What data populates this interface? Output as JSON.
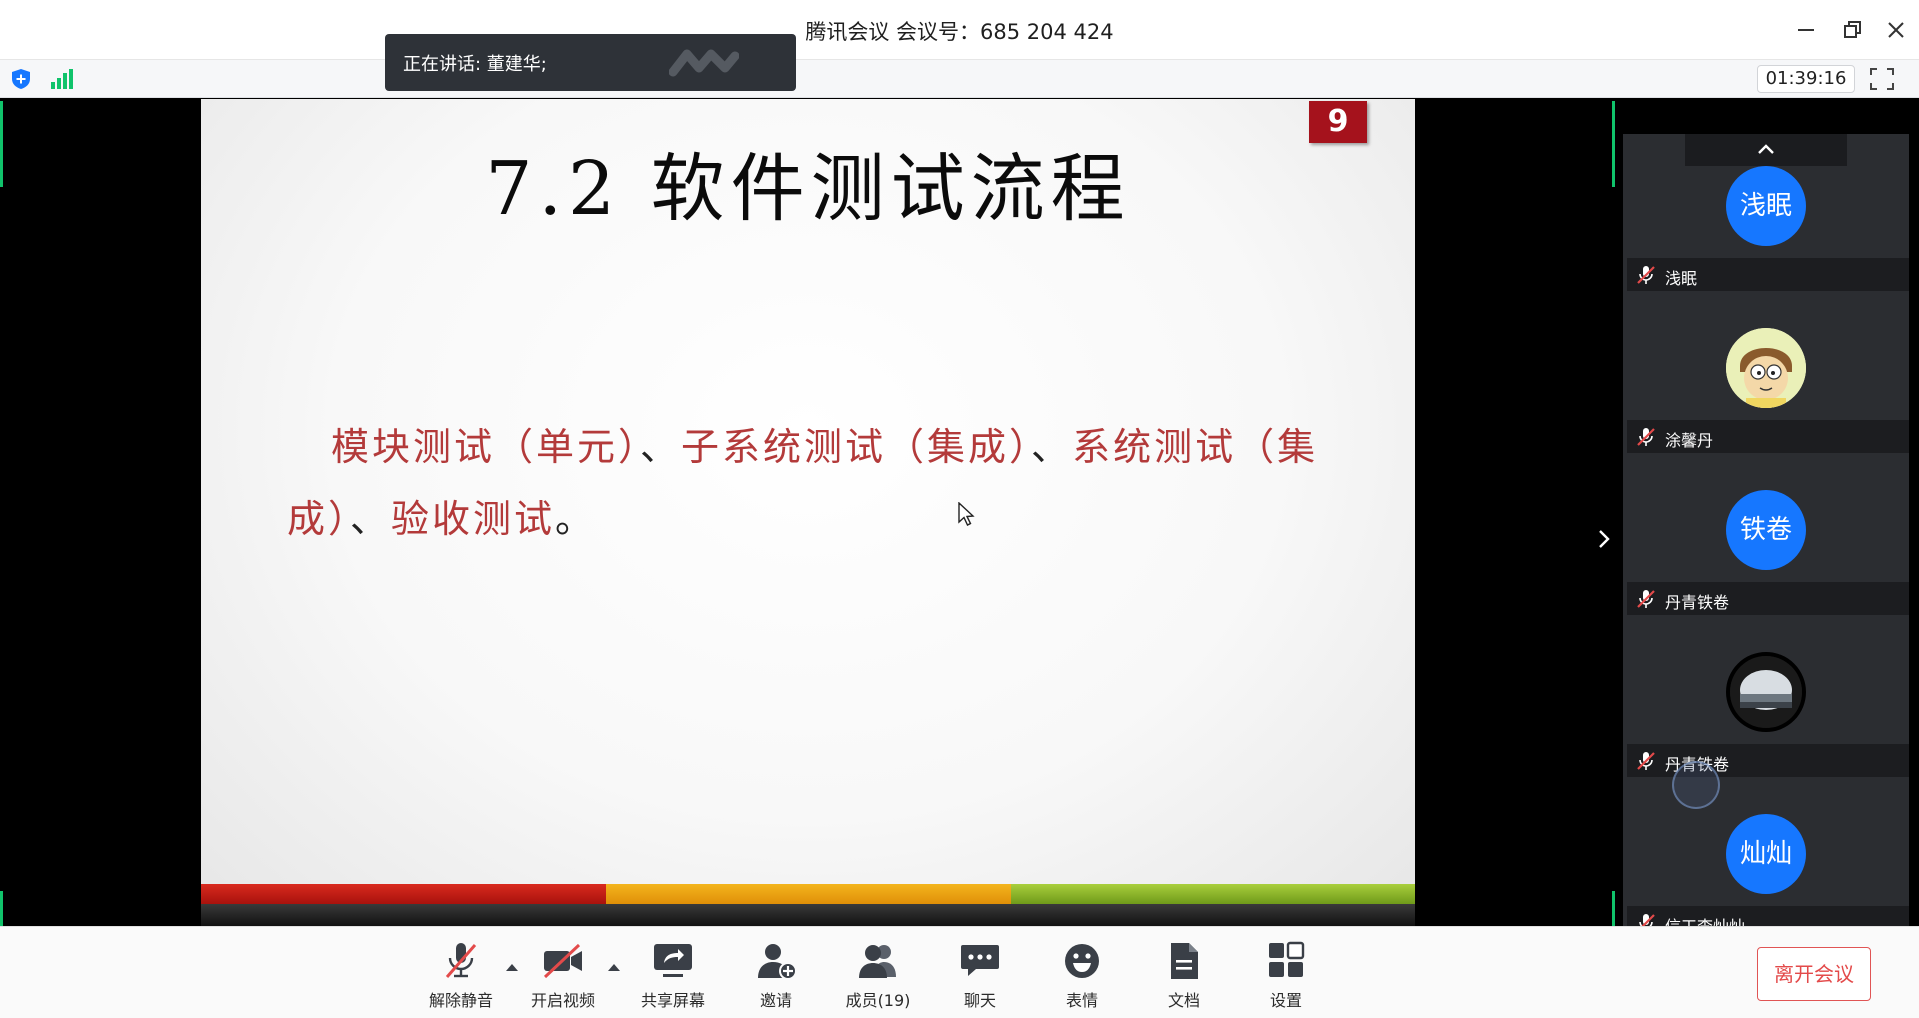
{
  "window": {
    "title": "腾讯会议 会议号：685 204 424",
    "elapsed_time": "01:39:16"
  },
  "speaking": {
    "text": "正在讲话: 董建华;"
  },
  "slide": {
    "page_number": "9",
    "title": "7.2 软件测试流程",
    "body_parts": [
      "模块测试（单元）",
      "、",
      "子系统测试（集成）",
      "、",
      "系统测试（集成）",
      "、",
      "验收测试",
      "。"
    ]
  },
  "participants": [
    {
      "avatar_text": "浅眠",
      "name": "浅眠",
      "avatar_kind": "initials",
      "color": "#1677ff"
    },
    {
      "avatar_text": "",
      "name": "涂馨丹",
      "avatar_kind": "cartoon"
    },
    {
      "avatar_text": "铁卷",
      "name": "丹青铁卷",
      "avatar_kind": "initials",
      "color": "#1677ff"
    },
    {
      "avatar_text": "",
      "name": "丹青铁卷",
      "avatar_kind": "photo"
    },
    {
      "avatar_text": "灿灿",
      "name": "信工李灿灿",
      "avatar_kind": "initials",
      "color": "#1677ff"
    }
  ],
  "controls": {
    "unmute": "解除静音",
    "start_video": "开启视频",
    "share_screen": "共享屏幕",
    "invite": "邀请",
    "members": "成员(19)",
    "chat": "聊天",
    "reactions": "表情",
    "docs": "文档",
    "settings": "设置",
    "leave": "离开会议"
  },
  "colors": {
    "accent_blue": "#1677ff",
    "slide_red": "#b33a3a",
    "badge_red": "#a5121c",
    "leave_red": "#e34a4a",
    "active_green": "#10c36b"
  },
  "icons": [
    "shield-icon",
    "signal-icon",
    "minimize-icon",
    "restore-icon",
    "close-icon",
    "fullscreen-icon",
    "chevron-up-icon",
    "chevron-right-icon",
    "mic-muted-icon",
    "camera-off-icon",
    "share-screen-icon",
    "invite-user-icon",
    "members-icon",
    "chat-icon",
    "emoji-icon",
    "document-icon",
    "settings-grid-icon"
  ]
}
